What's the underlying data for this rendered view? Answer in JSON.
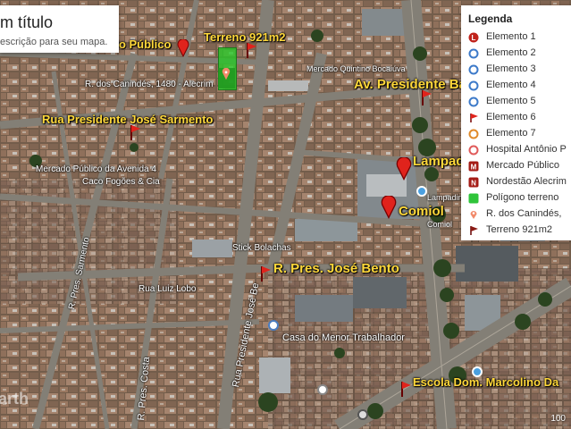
{
  "title_card": {
    "title": "m título",
    "description": "escrição para seu mapa."
  },
  "legend": {
    "title": "Legenda",
    "items": [
      {
        "label": "Elemento 1",
        "icon": "red-L-pin-icon"
      },
      {
        "label": "Elemento 2",
        "icon": "blue-circle-icon"
      },
      {
        "label": "Elemento 3",
        "icon": "blue-circle-icon"
      },
      {
        "label": "Elemento 4",
        "icon": "blue-circle-icon"
      },
      {
        "label": "Elemento 5",
        "icon": "blue-circle-icon"
      },
      {
        "label": "Elemento 6",
        "icon": "red-pin-icon"
      },
      {
        "label": "Elemento 7",
        "icon": "orange-circle-icon"
      },
      {
        "label": "Hospital Antônio P",
        "icon": "red-circle-icon"
      },
      {
        "label": "Mercado Público",
        "icon": "red-M-square-icon"
      },
      {
        "label": "Nordestão Alecrim",
        "icon": "red-N-square-icon"
      },
      {
        "label": "Polígono terreno",
        "icon": "green-square-icon"
      },
      {
        "label": "R. dos Canindés,",
        "icon": "red-dot-pin-icon"
      },
      {
        "label": "Terreno 921m2",
        "icon": "red-flag-icon"
      }
    ]
  },
  "map_labels": {
    "terreno": "Terreno 921m2",
    "publico": "do Público",
    "canindes": "R. dos Canindés, 1480 - Alecrim",
    "sarmento": "Rua Presidente José Sarmento",
    "bandeira": "Av. Presidente Ba",
    "lampadinha": "Lampadin",
    "comiol": "Comiol",
    "jose_bento": "R. Pres. José Bento",
    "escola": "Escola Dom. Marcolino Da",
    "mercado_avenida": "Mercado Público da Avenida 4",
    "caco": "Caco Fogões & Cia",
    "stick": "Stick Bolachas",
    "luiz_lobo": "Rua Luiz Lobo",
    "casa_menor": "Casa do Menor Trabalhador",
    "pres_jose_bento_vert": "Rua Presidente José Be",
    "r_pres_costa": "R. Pres. Costa",
    "r_pres_sarm": "R. Pres. Sarmento",
    "mercado_shop": "Mercado Quintino Bocaiúva",
    "comiol_small": "Comiol",
    "lampadinha_small": "Lampadin",
    "earth": "arth",
    "scale": "100"
  }
}
